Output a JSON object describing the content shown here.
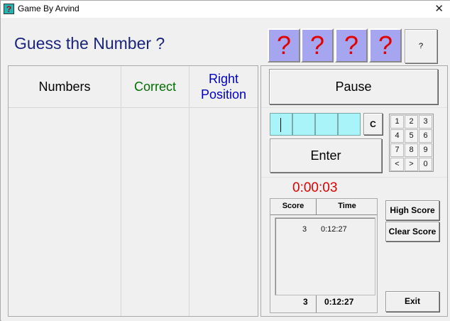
{
  "window": {
    "title": "Game By Arvind",
    "close_glyph": "✕",
    "app_icon_glyph": "?"
  },
  "heading": "Guess the Number ?",
  "hidden_digits": [
    "?",
    "?",
    "?",
    "?"
  ],
  "hint_button_label": "?",
  "columns": {
    "numbers": "Numbers",
    "correct": "Correct",
    "right_position": "Right\nPosition"
  },
  "colors": {
    "heading": "#1a237e",
    "correct": "#007000",
    "right_position": "#0000c0",
    "hidden_digit": "#e00000",
    "hidden_bg": "#a5a5f0",
    "input_bg": "#a8f4f8",
    "timer": "#e00000"
  },
  "controls": {
    "pause_label": "Pause",
    "clear_label": "C",
    "enter_label": "Enter",
    "keypad": [
      "1",
      "2",
      "3",
      "4",
      "5",
      "6",
      "7",
      "8",
      "9",
      "<",
      ">",
      "0"
    ]
  },
  "timer": "0:00:03",
  "scores": {
    "headers": {
      "score": "Score",
      "time": "Time"
    },
    "rows": [
      {
        "score": "3",
        "time": "0:12:27"
      }
    ],
    "best": {
      "score": "3",
      "time": "0:12:27"
    }
  },
  "buttons": {
    "high_score": "High Score",
    "clear_score": "Clear Score",
    "exit": "Exit"
  }
}
